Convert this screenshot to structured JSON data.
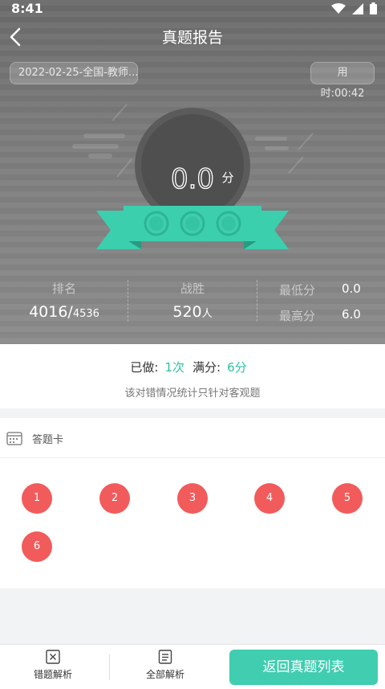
{
  "status": {
    "time": "8:41"
  },
  "nav": {
    "title": "真题报告"
  },
  "exam": {
    "name": "2022-02-25-全国-教师...",
    "time_used": "用时:00:42"
  },
  "score": {
    "value": "0.0",
    "unit": "分"
  },
  "stats": {
    "rank_label": "排名",
    "rank_value": "4016/",
    "rank_total": "4536",
    "beat_label": "战胜",
    "beat_value": "520",
    "beat_unit": "人",
    "min_label": "最低分",
    "min_value": "0.0",
    "max_label": "最高分",
    "max_value": "6.0"
  },
  "summary": {
    "done_label": "已做:",
    "done_value": "1次",
    "full_label": "满分:",
    "full_value": "6分",
    "note": "该对错情况统计只针对客观题"
  },
  "answer_card": {
    "title": "答题卡",
    "questions": [
      "1",
      "2",
      "3",
      "4",
      "5",
      "6"
    ]
  },
  "bottom": {
    "wrong_label": "错题解析",
    "all_label": "全部解析",
    "return_label": "返回真题列表"
  },
  "colors": {
    "accent": "#2bc2a3",
    "wrong": "#f25b5b",
    "primary": "#40cdb0",
    "ribbon": "#3ccfae"
  }
}
